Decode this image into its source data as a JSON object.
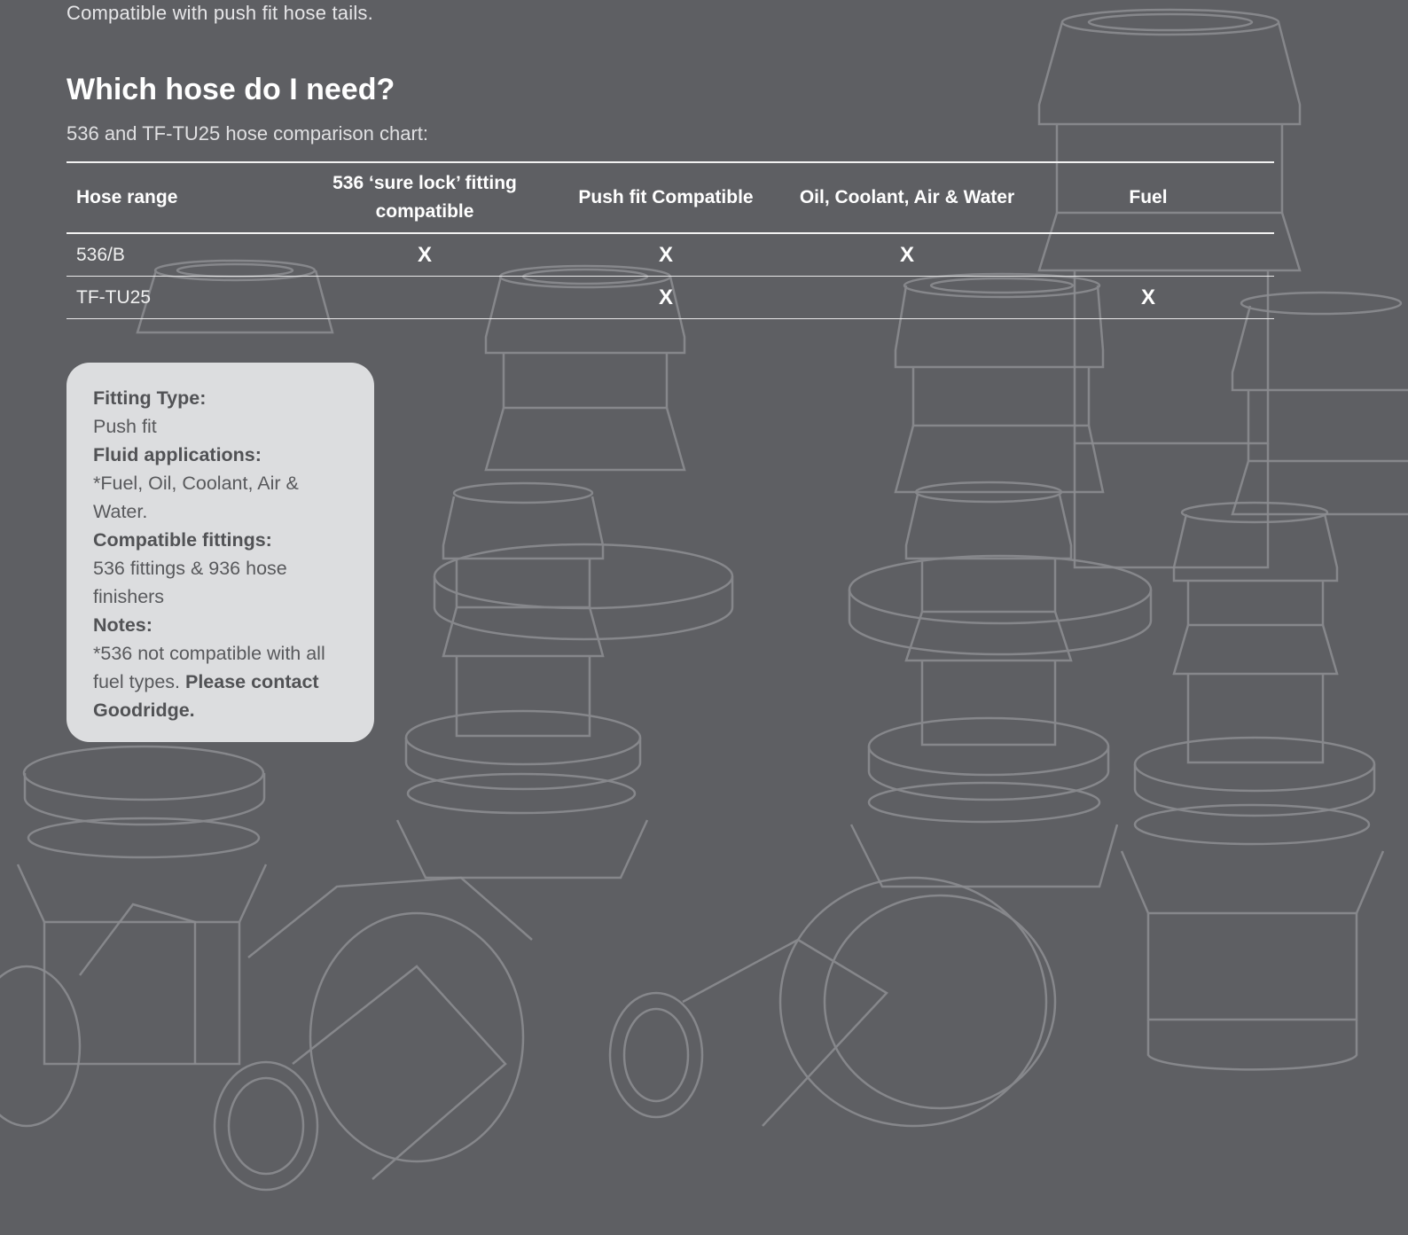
{
  "intro": {
    "text": "Compatible with push fit hose tails."
  },
  "heading": "Which hose do I need?",
  "subheading": "536 and TF-TU25  hose comparison chart:",
  "table": {
    "headers": [
      "Hose range",
      "536 ‘sure lock’ fitting compatible",
      "Push fit Compatible",
      "Oil, Coolant, Air & Water",
      "Fuel"
    ],
    "rows": [
      {
        "name": "536/B",
        "cells": [
          "X",
          "X",
          "X",
          ""
        ]
      },
      {
        "name": "TF-TU25",
        "cells": [
          "",
          "X",
          "",
          "X"
        ]
      }
    ]
  },
  "info_card": {
    "fitting_type_label": "Fitting Type:",
    "fitting_type_value": "Push fit",
    "fluid_label": "Fluid applications:",
    "fluid_value": "*Fuel, Oil, Coolant, Air & Water.",
    "compatible_label": "Compatible fittings:",
    "compatible_value": "536 fittings & 936 hose finishers",
    "notes_label": "Notes:",
    "notes_value": "*536 not compatible with all fuel types.",
    "notes_contact": "Please contact Goodridge."
  },
  "colors": {
    "background": "#5e5f63",
    "card": "#dcdddf",
    "line_art": "#8d8e92"
  }
}
